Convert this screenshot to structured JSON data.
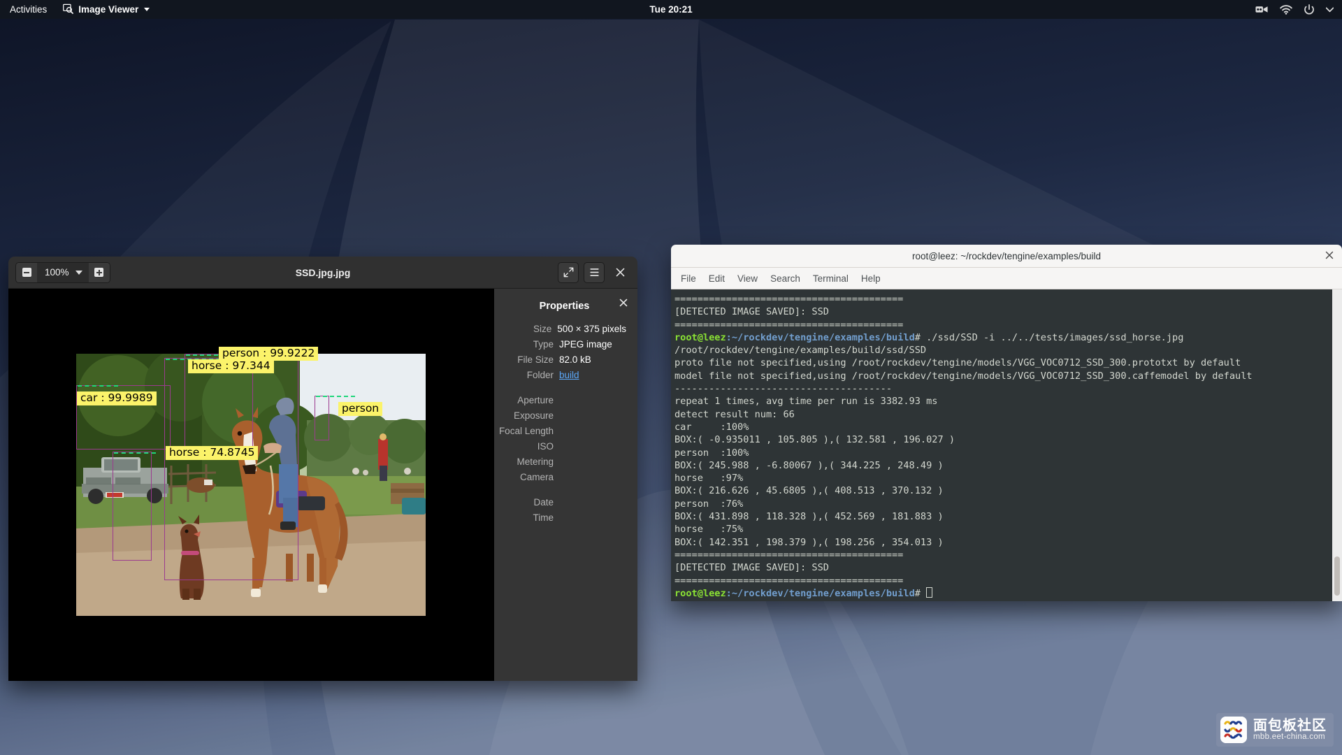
{
  "topbar": {
    "activities": "Activities",
    "app_name": "Image Viewer",
    "app_icon": "image-viewer-icon",
    "clock": "Tue 20:21",
    "icons": [
      "screencast-icon",
      "wifi-icon",
      "power-icon",
      "chevron-down-icon"
    ]
  },
  "image_viewer": {
    "title": "SSD.jpg.jpg",
    "zoom_level": "100%",
    "zoom_out_icon": "zoom-out-icon",
    "zoom_in_icon": "zoom-in-icon",
    "zoom_dropdown_icon": "chevron-down-icon",
    "fullscreen_icon": "fullscreen-icon",
    "menu_icon": "hamburger-menu-icon",
    "close_icon": "close-icon",
    "properties": {
      "title": "Properties",
      "close_icon": "close-icon",
      "rows": [
        {
          "key": "Size",
          "value": "500 × 375 pixels",
          "link": false
        },
        {
          "key": "Type",
          "value": "JPEG image",
          "link": false
        },
        {
          "key": "File Size",
          "value": "82.0 kB",
          "link": false
        },
        {
          "key": "Folder",
          "value": "build",
          "link": true
        }
      ],
      "exif_rows": [
        {
          "key": "Aperture",
          "value": ""
        },
        {
          "key": "Exposure",
          "value": ""
        },
        {
          "key": "Focal Length",
          "value": ""
        },
        {
          "key": "ISO",
          "value": ""
        },
        {
          "key": "Metering",
          "value": ""
        },
        {
          "key": "Camera",
          "value": ""
        }
      ],
      "date_rows": [
        {
          "key": "Date",
          "value": ""
        },
        {
          "key": "Time",
          "value": ""
        }
      ]
    },
    "detections": [
      {
        "label": "person : 99.9222"
      },
      {
        "label": "horse : 97.344"
      },
      {
        "label": "car : 99.9989"
      },
      {
        "label": "person"
      },
      {
        "label": "horse : 74.8745"
      }
    ],
    "detection_colors": {
      "label_bg": "#fbf36a",
      "box": "#9b3b8f",
      "dash": "#1fd67a"
    }
  },
  "terminal": {
    "title": "root@leez: ~/rockdev/tengine/examples/build",
    "close_icon": "close-icon",
    "menu": [
      "File",
      "Edit",
      "View",
      "Search",
      "Terminal",
      "Help"
    ],
    "prompt_user": "root@leez",
    "prompt_path": ":~/rockdev/tengine/examples/build",
    "prompt_sym": "#",
    "lines": [
      {
        "type": "plain",
        "text": "========================================"
      },
      {
        "type": "plain",
        "text": "[DETECTED IMAGE SAVED]: SSD"
      },
      {
        "type": "plain",
        "text": "========================================"
      },
      {
        "type": "prompt",
        "text": " ./ssd/SSD -i ../../tests/images/ssd_horse.jpg"
      },
      {
        "type": "plain",
        "text": "/root/rockdev/tengine/examples/build/ssd/SSD"
      },
      {
        "type": "plain",
        "text": "proto file not specified,using /root/rockdev/tengine/models/VGG_VOC0712_SSD_300.prototxt by default"
      },
      {
        "type": "plain",
        "text": "model file not specified,using /root/rockdev/tengine/models/VGG_VOC0712_SSD_300.caffemodel by default"
      },
      {
        "type": "plain",
        "text": "--------------------------------------"
      },
      {
        "type": "plain",
        "text": "repeat 1 times, avg time per run is 3382.93 ms"
      },
      {
        "type": "plain",
        "text": "detect result num: 66"
      },
      {
        "type": "plain",
        "text": "car     :100%"
      },
      {
        "type": "plain",
        "text": "BOX:( -0.935011 , 105.805 ),( 132.581 , 196.027 )"
      },
      {
        "type": "plain",
        "text": "person  :100%"
      },
      {
        "type": "plain",
        "text": "BOX:( 245.988 , -6.80067 ),( 344.225 , 248.49 )"
      },
      {
        "type": "plain",
        "text": "horse   :97%"
      },
      {
        "type": "plain",
        "text": "BOX:( 216.626 , 45.6805 ),( 408.513 , 370.132 )"
      },
      {
        "type": "plain",
        "text": "person  :76%"
      },
      {
        "type": "plain",
        "text": "BOX:( 431.898 , 118.328 ),( 452.569 , 181.883 )"
      },
      {
        "type": "plain",
        "text": "horse   :75%"
      },
      {
        "type": "plain",
        "text": "BOX:( 142.351 , 198.379 ),( 198.256 , 354.013 )"
      },
      {
        "type": "plain",
        "text": "========================================"
      },
      {
        "type": "plain",
        "text": "[DETECTED IMAGE SAVED]: SSD"
      },
      {
        "type": "plain",
        "text": "========================================"
      },
      {
        "type": "prompt-cursor",
        "text": " "
      }
    ]
  },
  "watermark": {
    "cn": "面包板社区",
    "url": "mbb.eet-china.com"
  }
}
